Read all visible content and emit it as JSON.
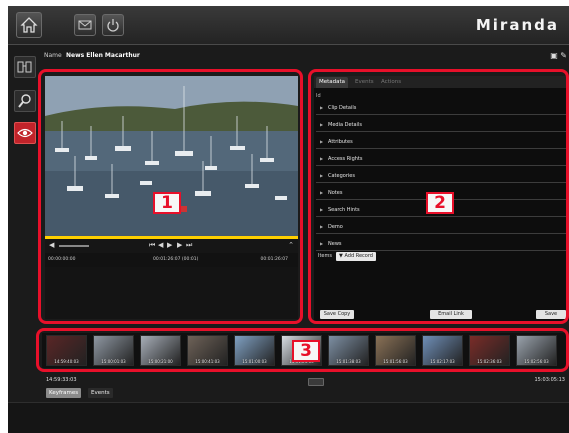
{
  "app": {
    "logo": "Miranda",
    "colors": {
      "accent": "#e8102a",
      "highlight_active": "#c1232a",
      "progress": "#ffd000"
    }
  },
  "toolbar": {
    "icons": [
      "home-icon",
      "mail-icon",
      "power-icon"
    ]
  },
  "asset": {
    "name_label": "Name",
    "name_value": "News Ellen Macarthur"
  },
  "rail": {
    "icons": [
      "browse-icon",
      "search-icon",
      "eye-icon"
    ]
  },
  "callouts": [
    "1",
    "2",
    "3"
  ],
  "player": {
    "timecode_in": "00:00:00:00",
    "timecode_current": "00:01:26:07 (00:01)",
    "timecode_out": "00:01:26:07"
  },
  "metadata": {
    "tabs": [
      "Metadata",
      "Events",
      "Actions"
    ],
    "active_tab": "Metadata",
    "id_label": "Id",
    "sections": [
      "Clip Details",
      "Media Details",
      "Attributes",
      "Access Rights",
      "Categories",
      "Notes",
      "Search Hints",
      "Demo",
      "News"
    ],
    "items_label": "Items",
    "add_record_label": "Add Record",
    "buttons": {
      "save_copy": "Save Copy",
      "email_link": "Email Link",
      "save": "Save"
    }
  },
  "filmstrip": {
    "thumbnails": [
      {
        "tc": "14:59:40:03",
        "color": "#5a2626"
      },
      {
        "tc": "15:00:01:03",
        "color": "#8f98a3"
      },
      {
        "tc": "15:00:21:00",
        "color": "#a7aeb8"
      },
      {
        "tc": "15:00:41:03",
        "color": "#6e6258"
      },
      {
        "tc": "15:01:00:03",
        "color": "#7fa0c2"
      },
      {
        "tc": "15:01:21:03",
        "color": "#d8dde3"
      },
      {
        "tc": "15:01:38:03",
        "color": "#7d8fa3"
      },
      {
        "tc": "15:01:56:03",
        "color": "#8a7156"
      },
      {
        "tc": "15:02:17:03",
        "color": "#6f8fb8"
      },
      {
        "tc": "15:02:36:03",
        "color": "#7a2c28"
      },
      {
        "tc": "15:02:56:03",
        "color": "#9aa3ad"
      }
    ],
    "start_tc": "14:59:33:03",
    "end_tc": "15:03:05:13"
  },
  "bottom_tabs": [
    "Keyframes",
    "Events"
  ],
  "active_bottom_tab": "Keyframes"
}
